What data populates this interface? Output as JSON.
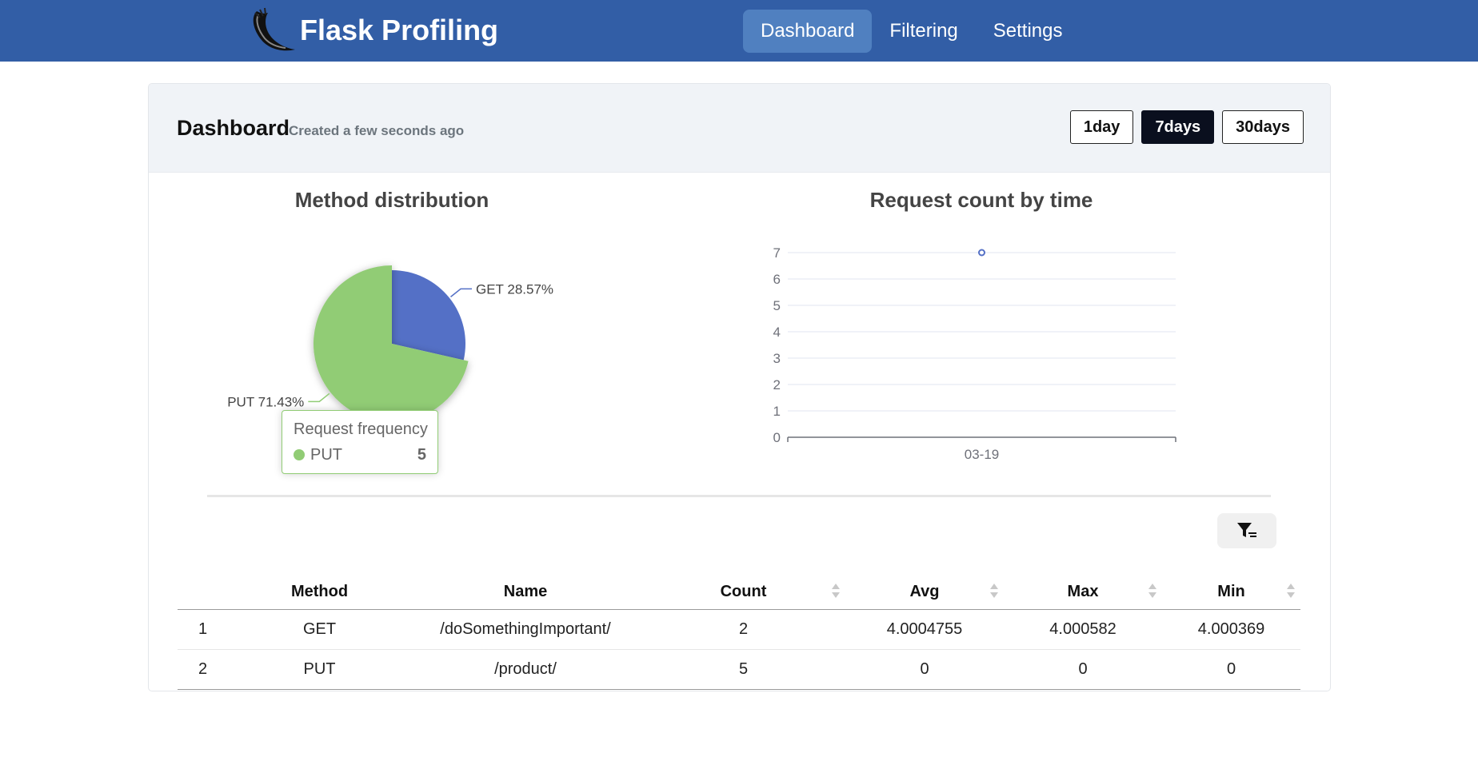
{
  "navbar": {
    "brand_name": "Flask Profiling",
    "items": [
      {
        "label": "Dashboard",
        "active": true
      },
      {
        "label": "Filtering",
        "active": false
      },
      {
        "label": "Settings",
        "active": false
      }
    ],
    "color": "#325ea6"
  },
  "dashboard": {
    "title": "Dashboard",
    "subtitle": "Created a few seconds ago",
    "ranges": [
      {
        "label": "1day",
        "active": false
      },
      {
        "label": "7days",
        "active": true
      },
      {
        "label": "30days",
        "active": false
      }
    ]
  },
  "charts": {
    "pie_title": "Method distribution",
    "line_title": "Request count by time",
    "tooltip": {
      "title": "Request frequency",
      "name": "PUT",
      "value": "5"
    }
  },
  "chart_data": [
    {
      "type": "pie",
      "title": "Method distribution",
      "slices": [
        {
          "label": "GET",
          "value": 2,
          "percent": "28.57%",
          "color": "#5470c6"
        },
        {
          "label": "PUT",
          "value": 5,
          "percent": "71.43%",
          "color": "#91cc75"
        }
      ]
    },
    {
      "type": "line",
      "title": "Request count by time",
      "categories": [
        "03-19"
      ],
      "values": [
        7
      ],
      "ylim": [
        0,
        7
      ],
      "yticks": [
        "0",
        "1",
        "2",
        "3",
        "4",
        "5",
        "6",
        "7"
      ],
      "grid": true,
      "color": "#5470c6"
    }
  ],
  "table": {
    "columns": [
      "",
      "Method",
      "Name",
      "Count",
      "Avg",
      "Max",
      "Min"
    ],
    "rows": [
      [
        "1",
        "GET",
        "/doSomethingImportant/",
        "2",
        "4.0004755",
        "4.000582",
        "4.000369"
      ],
      [
        "2",
        "PUT",
        "/product/",
        "5",
        "0",
        "0",
        "0"
      ]
    ]
  },
  "icons": {
    "brand_logo": "flask-horn-logo-icon",
    "filter": "filter-icon",
    "sort": "sort-icon"
  }
}
